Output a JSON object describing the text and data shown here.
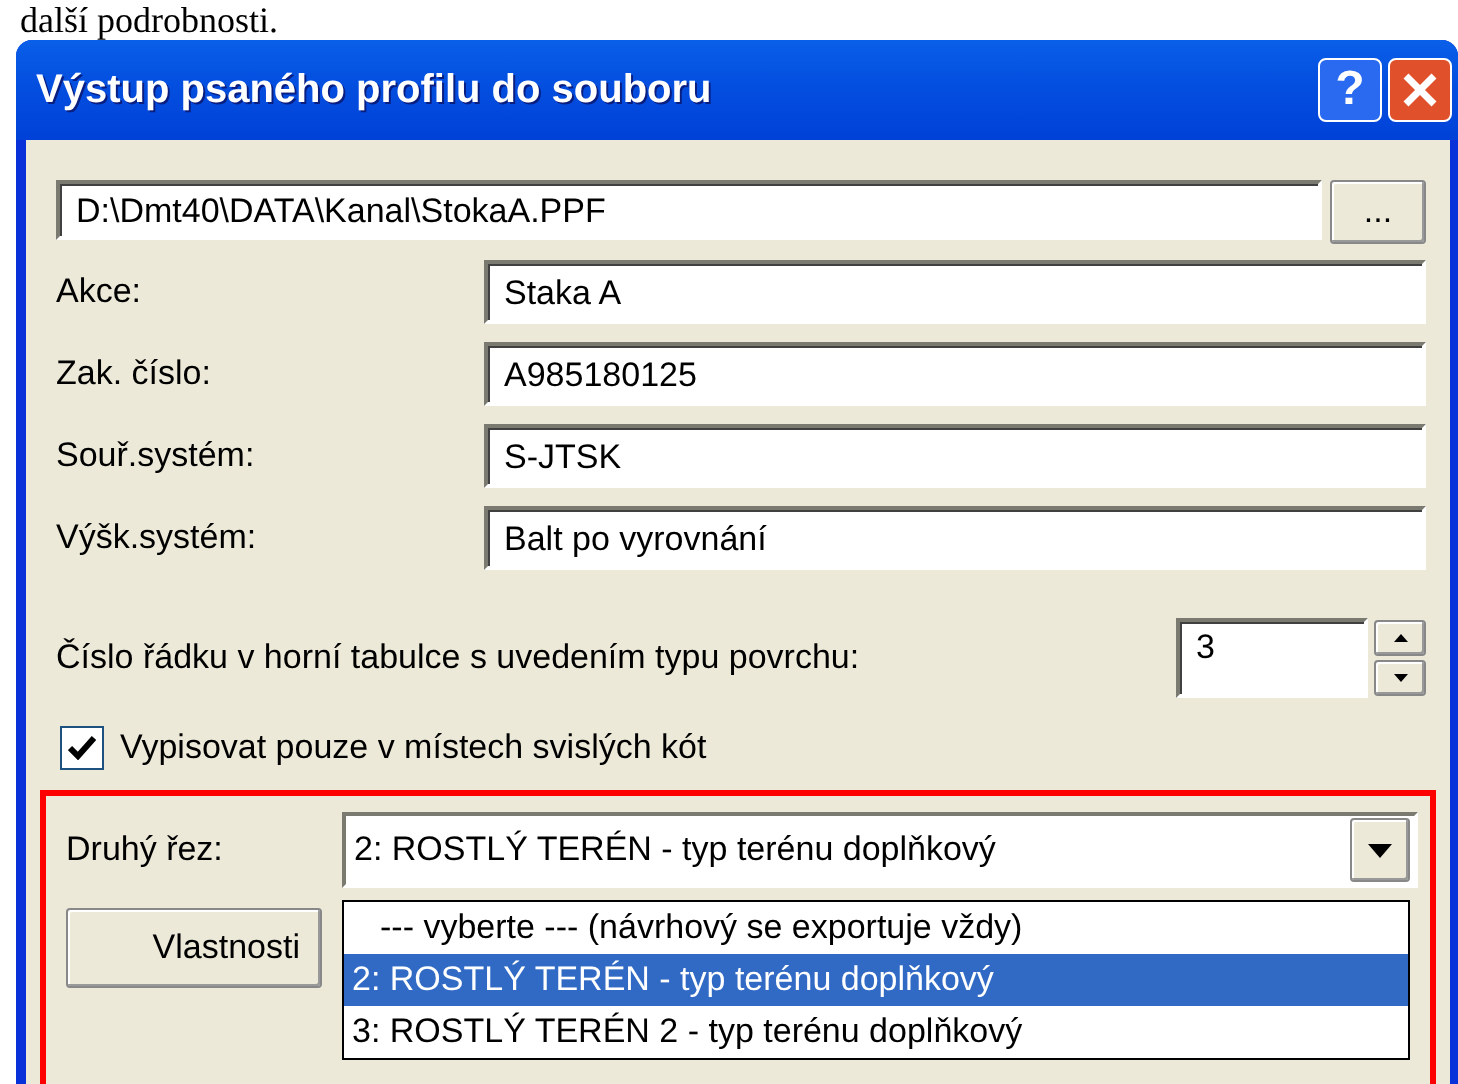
{
  "caption_fragment": "další podrobnosti.",
  "window": {
    "title": "Výstup psaného profilu do souboru",
    "help_label": "?"
  },
  "file_path": {
    "value": "D:\\Dmt40\\DATA\\Kanal\\StokaA.PPF",
    "browse_label": "..."
  },
  "fields": [
    {
      "label": "Akce:",
      "value": "Staka A"
    },
    {
      "label": "Zak. číslo:",
      "value": "A985180125"
    },
    {
      "label": "Souř.systém:",
      "value": "S-JTSK"
    },
    {
      "label": "Výšk.systém:",
      "value": "Balt po vyrovnání"
    }
  ],
  "row_number": {
    "label": "Číslo řádku v horní tabulce s uvedením typu povrchu:",
    "value": "3"
  },
  "checkbox": {
    "label": "Vypisovat pouze v místech svislých kót",
    "checked": true
  },
  "second_section": {
    "highlighted": true,
    "label": "Druhý řez:",
    "value": "2: ROSTLÝ TERÉN - typ terénu doplňkový",
    "properties_button": "Vlastnosti",
    "expanded": true,
    "options": [
      {
        "label": "--- vyberte --- (návrhový se exportuje vždy)",
        "selected": false
      },
      {
        "label": "2: ROSTLÝ TERÉN - typ terénu doplňkový",
        "selected": true
      },
      {
        "label": "3: ROSTLÝ TERÉN 2 - typ terénu doplňkový",
        "selected": false
      }
    ]
  }
}
